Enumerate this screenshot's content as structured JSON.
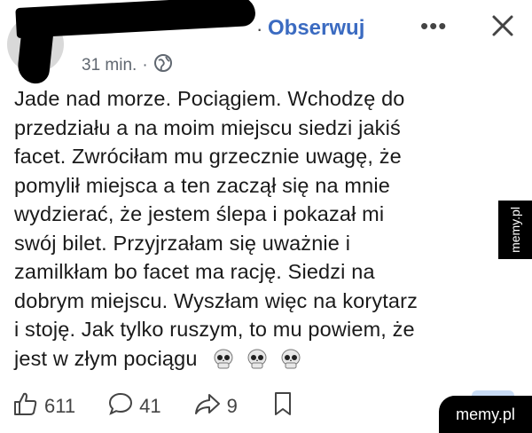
{
  "header": {
    "follow_label": "Obserwuj",
    "time_label": "31 min."
  },
  "post": {
    "lines": [
      "Jade nad morze. Pociągiem. Wchodzę do",
      "przedziału a na moim miejscu siedzi jakiś",
      "facet. Zwróciłam mu grzecznie uwagę, że",
      "pomylił miejsca a ten zaczął się na mnie",
      "wydzierać, że jestem ślepa i pokazał mi",
      "swój bilet. Przyjrzałam się uważnie i",
      "zamilkłam bo facet ma rację. Siedzi na",
      "dobrym miejscu. Wyszłam więc na korytarz",
      "i stoję. Jak tylko ruszym, to mu powiem, że",
      "jest w złym pociągu"
    ]
  },
  "actions": {
    "likes": "611",
    "comments": "41",
    "shares": "9"
  },
  "watermarks": {
    "side": "memy.pl",
    "corner": "memy.pl"
  },
  "icons": {
    "globe": "globe-icon",
    "close": "close-icon",
    "more": "more-dots-icon",
    "like": "thumbs-up-icon",
    "comment": "comment-icon",
    "share": "share-icon",
    "save": "bookmark-icon",
    "emoji": "skull-icon"
  },
  "colors": {
    "link": "#3b6bc1",
    "text": "#1a1a1a",
    "muted": "#606770"
  }
}
